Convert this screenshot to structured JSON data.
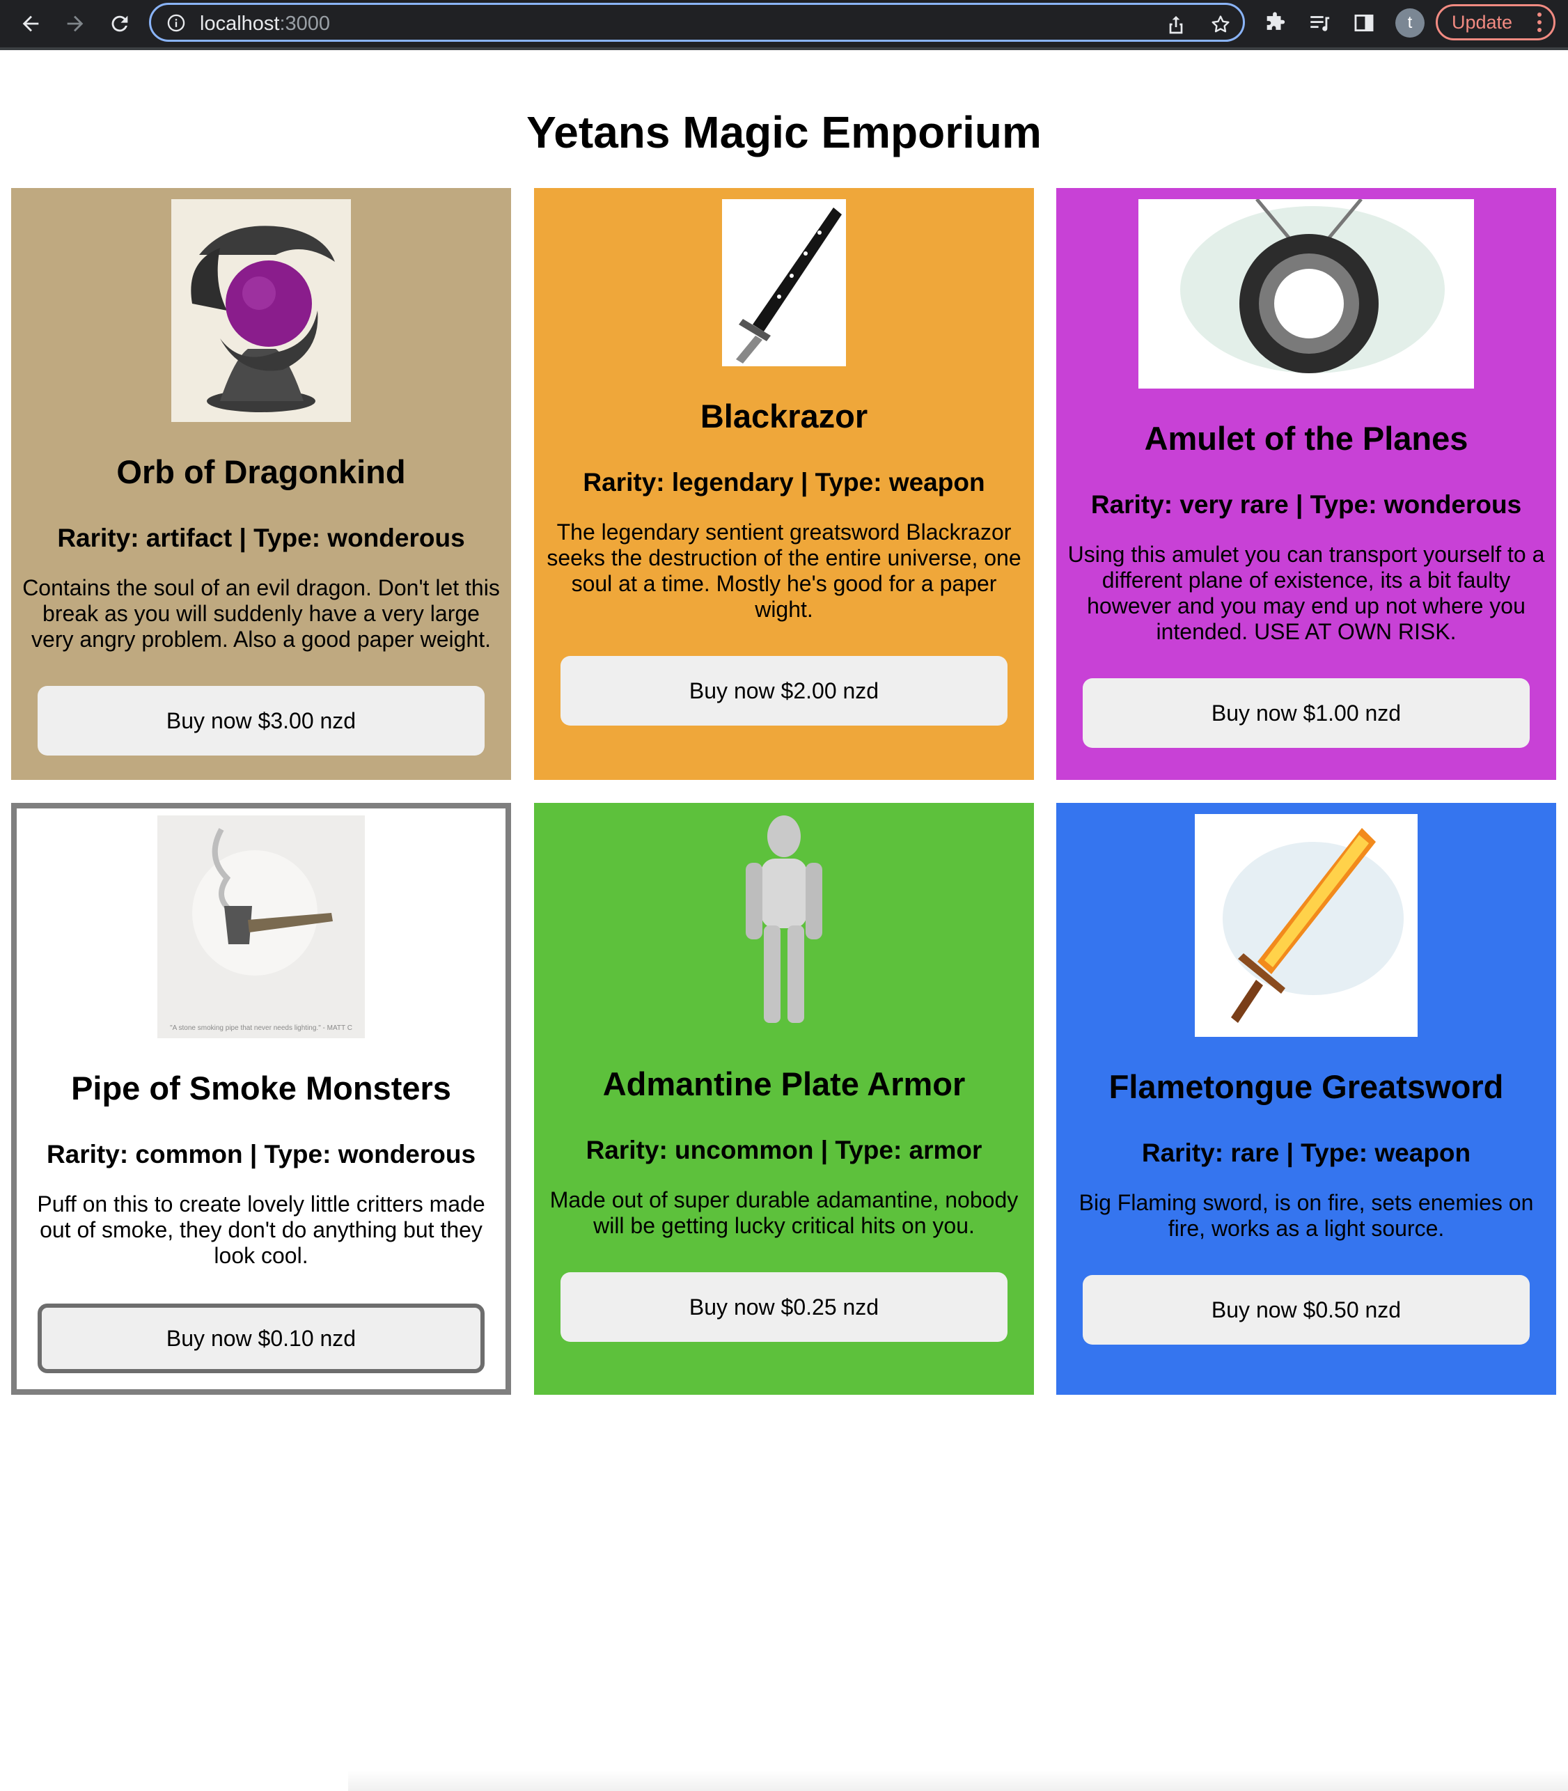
{
  "browser": {
    "url_host": "localhost",
    "url_port": ":3000",
    "avatar_letter": "t",
    "update_label": "Update"
  },
  "page": {
    "title": "Yetans Magic Emporium"
  },
  "products": [
    {
      "name": "Orb of Dragonkind",
      "meta": "Rarity: artifact | Type: wonderous",
      "description": "Contains the soul of an evil dragon. Don't let this break as you will suddenly have a very large very angry problem. Also a good paper weight.",
      "button": "Buy now $3.00 nzd",
      "color": "#bfa980",
      "image": "orb-dragon-image"
    },
    {
      "name": "Blackrazor",
      "meta": "Rarity: legendary | Type: weapon",
      "description": "The legendary sentient greatsword Blackrazor seeks the destruction of the entire universe, one soul at a time. Mostly he's good for a paper wight.",
      "button": "Buy now $2.00 nzd",
      "color": "#efa73a",
      "image": "black-sword-image"
    },
    {
      "name": "Amulet of the Planes",
      "meta": "Rarity: very rare | Type: wonderous",
      "description": "Using this amulet you can transport yourself to a different plane of existence, its a bit faulty however and you may end up not where you intended. USE AT OWN RISK.",
      "button": "Buy now $1.00 nzd",
      "color": "#c841d6",
      "image": "amulet-image"
    },
    {
      "name": "Pipe of Smoke Monsters",
      "meta": "Rarity: common | Type: wonderous",
      "description": "Puff on this to create lovely little critters made out of smoke, they don't do anything but they look cool.",
      "button": "Buy now $0.10 nzd",
      "color": "#ffffff",
      "image": "pipe-image",
      "image_caption": "\"A stone smoking pipe that never needs lighting.\" - MATT C"
    },
    {
      "name": "Admantine Plate Armor",
      "meta": "Rarity: uncommon | Type: armor",
      "description": "Made out of super durable adamantine, nobody will be getting lucky critical hits on you.",
      "button": "Buy now $0.25 nzd",
      "color": "#5dc13c",
      "image": "armor-image"
    },
    {
      "name": "Flametongue Greatsword",
      "meta": "Rarity: rare | Type: weapon",
      "description": "Big Flaming sword, is on fire, sets enemies on fire, works as a light source.",
      "button": "Buy now $0.50 nzd",
      "color": "#3575ef",
      "image": "flame-sword-image"
    }
  ]
}
